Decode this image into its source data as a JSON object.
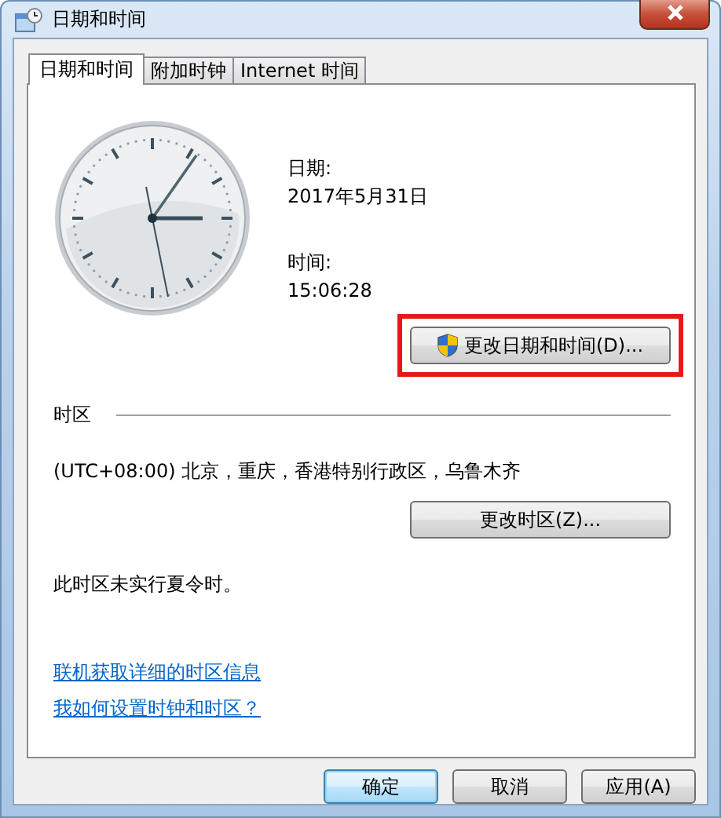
{
  "window": {
    "title": "日期和时间"
  },
  "tabs": [
    {
      "label": "日期和时间",
      "selected": true
    },
    {
      "label": "附加时钟",
      "selected": false
    },
    {
      "label": "Internet 时间",
      "selected": false
    }
  ],
  "date": {
    "label": "日期:",
    "value": "2017年5月31日"
  },
  "time": {
    "label": "时间:",
    "value": "15:06:28"
  },
  "change_datetime_button": {
    "label": "更改日期和时间(D)...",
    "highlighted": true
  },
  "timezone": {
    "heading": "时区",
    "value": "(UTC+08:00) 北京，重庆，香港特别行政区，乌鲁木齐",
    "button": "更改时区(Z)...",
    "dst_note": "此时区未实行夏令时。"
  },
  "links": [
    "联机获取详细的时区信息",
    "我如何设置时钟和时区？"
  ],
  "buttons": [
    {
      "label": "确定",
      "default": true
    },
    {
      "label": "取消",
      "default": false
    },
    {
      "label": "应用(A)",
      "default": false
    }
  ]
}
